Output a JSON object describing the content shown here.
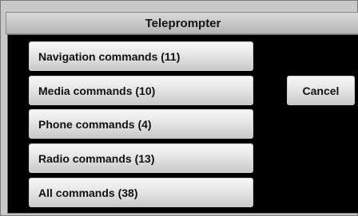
{
  "window": {
    "title": "Teleprompter"
  },
  "commands": [
    {
      "label": "Navigation commands (11)"
    },
    {
      "label": "Media commands (10)"
    },
    {
      "label": "Phone commands (4)"
    },
    {
      "label": "Radio commands (13)"
    },
    {
      "label": "All commands (38)"
    }
  ],
  "actions": {
    "cancel_label": "Cancel"
  },
  "colors": {
    "panel_background": "#000000",
    "button_top": "#f7f7f7",
    "button_bottom": "#c9c9c9",
    "text": "#111111"
  }
}
